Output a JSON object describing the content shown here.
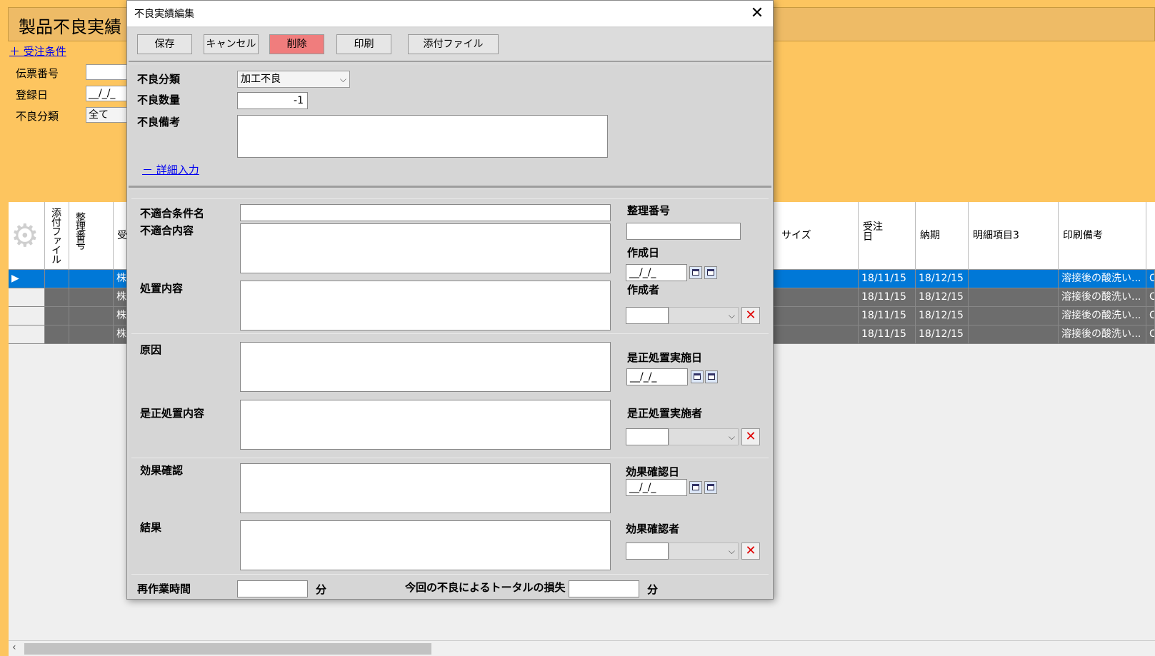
{
  "background": {
    "title": "製品不良実績",
    "link_order_conditions": "＋ 受注条件",
    "filters": [
      {
        "label": "伝票番号",
        "value": ""
      },
      {
        "label": "登録日",
        "value": "__/_/_"
      },
      {
        "label": "不良分類",
        "value": "全て"
      }
    ],
    "grid": {
      "headers": {
        "attach": "添付ファイル",
        "seiri": "整理番号",
        "ju": "受",
        "size": "サイズ",
        "order_date": "受注日",
        "due": "納期",
        "detail3": "明細項目3",
        "print_note": "印刷備考"
      },
      "rows": [
        {
          "col1": "株",
          "order_date": "18/11/15",
          "due": "18/12/15",
          "detail3": "",
          "print_note": "溶接後の酸洗い...",
          "tail": "C"
        },
        {
          "col1": "株",
          "order_date": "18/11/15",
          "due": "18/12/15",
          "detail3": "",
          "print_note": "溶接後の酸洗い...",
          "tail": "C"
        },
        {
          "col1": "株",
          "order_date": "18/11/15",
          "due": "18/12/15",
          "detail3": "",
          "print_note": "溶接後の酸洗い...",
          "tail": "C"
        },
        {
          "col1": "株",
          "order_date": "18/11/15",
          "due": "18/12/15",
          "detail3": "",
          "print_note": "溶接後の酸洗い...",
          "tail": "C"
        }
      ],
      "colors": {
        "selected_row": "#0078d7",
        "other_rows": "#6d6d6d"
      }
    }
  },
  "dialog": {
    "title": "不良実績編集",
    "toolbar": {
      "save": "保存",
      "cancel": "キャンセル",
      "delete": "削除",
      "print": "印刷",
      "attach": "添付ファイル"
    },
    "defect_category_label": "不良分類",
    "defect_category_value": "加工不良",
    "defect_qty_label": "不良数量",
    "defect_qty_value": "-1",
    "defect_note_label": "不良備考",
    "detail_link": "－ 詳細入力",
    "nc_condition_label": "不適合条件名",
    "nc_content_label": "不適合内容",
    "treatment_label": "処置内容",
    "cause_label": "原因",
    "corrective_label": "是正処置内容",
    "effect_label": "効果確認",
    "result_label": "結果",
    "seiri_label": "整理番号",
    "created_date_label": "作成日",
    "creator_label": "作成者",
    "corrective_date_label": "是正処置実施日",
    "corrective_person_label": "是正処置実施者",
    "effect_date_label": "効果確認日",
    "effect_person_label": "効果確認者",
    "date_placeholder": "__/_/_",
    "rework_label": "再作業時間",
    "minutes_unit": "分",
    "total_loss_label": "今回の不良によるトータルの損失",
    "clear_symbol": "✕",
    "close_symbol": "✕"
  }
}
